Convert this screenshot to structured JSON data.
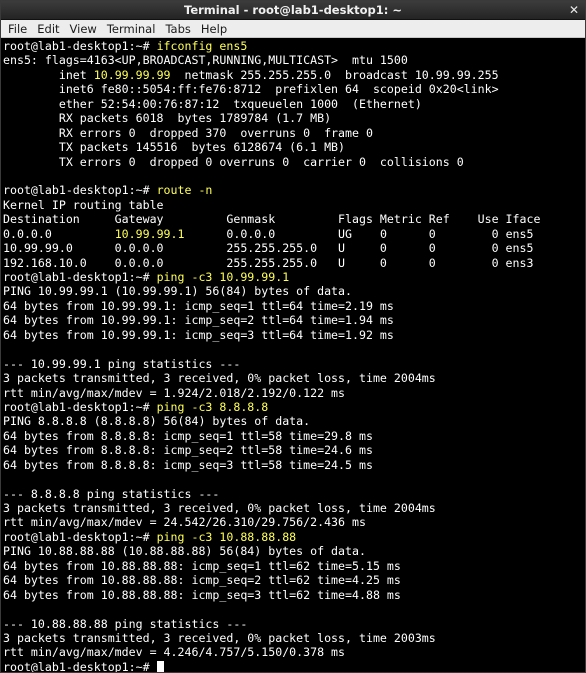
{
  "window": {
    "title": "Terminal - root@lab1-desktop1: ~",
    "close_icon": "close-icon"
  },
  "menu": [
    "File",
    "Edit",
    "View",
    "Terminal",
    "Tabs",
    "Help"
  ],
  "colors": {
    "background": "#000000",
    "text": "#ffffff",
    "highlight": "#ffff55"
  },
  "terminal": {
    "lines": [
      [
        {
          "t": "root@lab1-desktop1:~# "
        },
        {
          "t": "ifconfig ens5",
          "hl": true
        }
      ],
      [
        {
          "t": "ens5: flags=4163<UP,BROADCAST,RUNNING,MULTICAST>  mtu 1500"
        }
      ],
      [
        {
          "t": "        inet "
        },
        {
          "t": "10.99.99.99",
          "hl": true
        },
        {
          "t": "  netmask 255.255.255.0  broadcast 10.99.99.255"
        }
      ],
      [
        {
          "t": "        inet6 fe80::5054:ff:fe76:8712  prefixlen 64  scopeid 0x20<link>"
        }
      ],
      [
        {
          "t": "        ether 52:54:00:76:87:12  txqueuelen 1000  (Ethernet)"
        }
      ],
      [
        {
          "t": "        RX packets 6018  bytes 1789784 (1.7 MB)"
        }
      ],
      [
        {
          "t": "        RX errors 0  dropped 370  overruns 0  frame 0"
        }
      ],
      [
        {
          "t": "        TX packets 145516  bytes 6128674 (6.1 MB)"
        }
      ],
      [
        {
          "t": "        TX errors 0  dropped 0 overruns 0  carrier 0  collisions 0"
        }
      ],
      [
        {
          "t": ""
        }
      ],
      [
        {
          "t": "root@lab1-desktop1:~# "
        },
        {
          "t": "route -n",
          "hl": true
        }
      ],
      [
        {
          "t": "Kernel IP routing table"
        }
      ],
      [
        {
          "t": "Destination     Gateway         Genmask         Flags Metric Ref    Use Iface"
        }
      ],
      [
        {
          "t": "0.0.0.0         "
        },
        {
          "t": "10.99.99.1",
          "hl": true
        },
        {
          "t": "      0.0.0.0         UG    0      0        0 ens5"
        }
      ],
      [
        {
          "t": "10.99.99.0      0.0.0.0         255.255.255.0   U     0      0        0 ens5"
        }
      ],
      [
        {
          "t": "192.168.10.0    0.0.0.0         255.255.255.0   U     0      0        0 ens3"
        }
      ],
      [
        {
          "t": "root@lab1-desktop1:~# "
        },
        {
          "t": "ping -c3 10.99.99.1",
          "hl": true
        }
      ],
      [
        {
          "t": "PING 10.99.99.1 (10.99.99.1) 56(84) bytes of data."
        }
      ],
      [
        {
          "t": "64 bytes from 10.99.99.1: icmp_seq=1 ttl=64 time=2.19 ms"
        }
      ],
      [
        {
          "t": "64 bytes from 10.99.99.1: icmp_seq=2 ttl=64 time=1.94 ms"
        }
      ],
      [
        {
          "t": "64 bytes from 10.99.99.1: icmp_seq=3 ttl=64 time=1.92 ms"
        }
      ],
      [
        {
          "t": ""
        }
      ],
      [
        {
          "t": "--- 10.99.99.1 ping statistics ---"
        }
      ],
      [
        {
          "t": "3 packets transmitted, 3 received, 0% packet loss, time 2004ms"
        }
      ],
      [
        {
          "t": "rtt min/avg/max/mdev = 1.924/2.018/2.192/0.122 ms"
        }
      ],
      [
        {
          "t": "root@lab1-desktop1:~# "
        },
        {
          "t": "ping -c3 8.8.8.8",
          "hl": true
        }
      ],
      [
        {
          "t": "PING 8.8.8.8 (8.8.8.8) 56(84) bytes of data."
        }
      ],
      [
        {
          "t": "64 bytes from 8.8.8.8: icmp_seq=1 ttl=58 time=29.8 ms"
        }
      ],
      [
        {
          "t": "64 bytes from 8.8.8.8: icmp_seq=2 ttl=58 time=24.6 ms"
        }
      ],
      [
        {
          "t": "64 bytes from 8.8.8.8: icmp_seq=3 ttl=58 time=24.5 ms"
        }
      ],
      [
        {
          "t": ""
        }
      ],
      [
        {
          "t": "--- 8.8.8.8 ping statistics ---"
        }
      ],
      [
        {
          "t": "3 packets transmitted, 3 received, 0% packet loss, time 2004ms"
        }
      ],
      [
        {
          "t": "rtt min/avg/max/mdev = 24.542/26.310/29.756/2.436 ms"
        }
      ],
      [
        {
          "t": "root@lab1-desktop1:~# "
        },
        {
          "t": "ping -c3 10.88.88.88",
          "hl": true
        }
      ],
      [
        {
          "t": "PING 10.88.88.88 (10.88.88.88) 56(84) bytes of data."
        }
      ],
      [
        {
          "t": "64 bytes from 10.88.88.88: icmp_seq=1 ttl=62 time=5.15 ms"
        }
      ],
      [
        {
          "t": "64 bytes from 10.88.88.88: icmp_seq=2 ttl=62 time=4.25 ms"
        }
      ],
      [
        {
          "t": "64 bytes from 10.88.88.88: icmp_seq=3 ttl=62 time=4.88 ms"
        }
      ],
      [
        {
          "t": ""
        }
      ],
      [
        {
          "t": "--- 10.88.88.88 ping statistics ---"
        }
      ],
      [
        {
          "t": "3 packets transmitted, 3 received, 0% packet loss, time 2003ms"
        }
      ],
      [
        {
          "t": "rtt min/avg/max/mdev = 4.246/4.757/5.150/0.378 ms"
        }
      ],
      [
        {
          "t": "root@lab1-desktop1:~# "
        }
      ]
    ]
  }
}
